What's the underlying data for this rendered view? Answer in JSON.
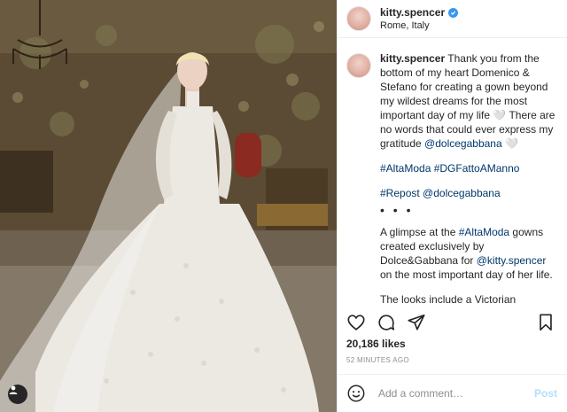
{
  "post": {
    "username": "kitty.spencer",
    "location": "Rome, Italy",
    "caption": {
      "username": "kitty.spencer",
      "p1_text": "Thank you from the bottom of my heart Domenico & Stefano for creating a gown beyond my wildest dreams for the most important day of my life 🤍 There are no words that could ever express my gratitude ",
      "p1_mention": "@dolcegabbana",
      "p1_end": " 🤍",
      "tags": "#AltaModa #DGFattoAManno",
      "repost_tag": "#Repost",
      "repost_mention": "@dolcegabbana",
      "dots": "• • •",
      "p3_a": "A glimpse at the ",
      "p3_tag": "#AltaModa",
      "p3_b": " gowns created exclusively by Dolce&Gabbana for ",
      "p3_mention": "@kitty.spencer",
      "p3_c": " on the most important day of her life.",
      "p4": "The looks include a Victorian inspiration lace bridal gown."
    },
    "likes": "20,186 likes",
    "time": "52 MINUTES AGO",
    "comment_placeholder": "Add a comment…",
    "post_label": "Post"
  },
  "icons": {
    "like": "heart-icon",
    "comment": "comment-icon",
    "share": "paper-plane-icon",
    "save": "bookmark-icon",
    "emoji": "smiley-icon",
    "verified": "verified-badge-icon",
    "tagged_user": "user-tag-icon"
  },
  "colors": {
    "link": "#00376b",
    "verified": "#3897f0",
    "post_disabled": "#b2dffc",
    "muted": "#8e8e8e"
  }
}
